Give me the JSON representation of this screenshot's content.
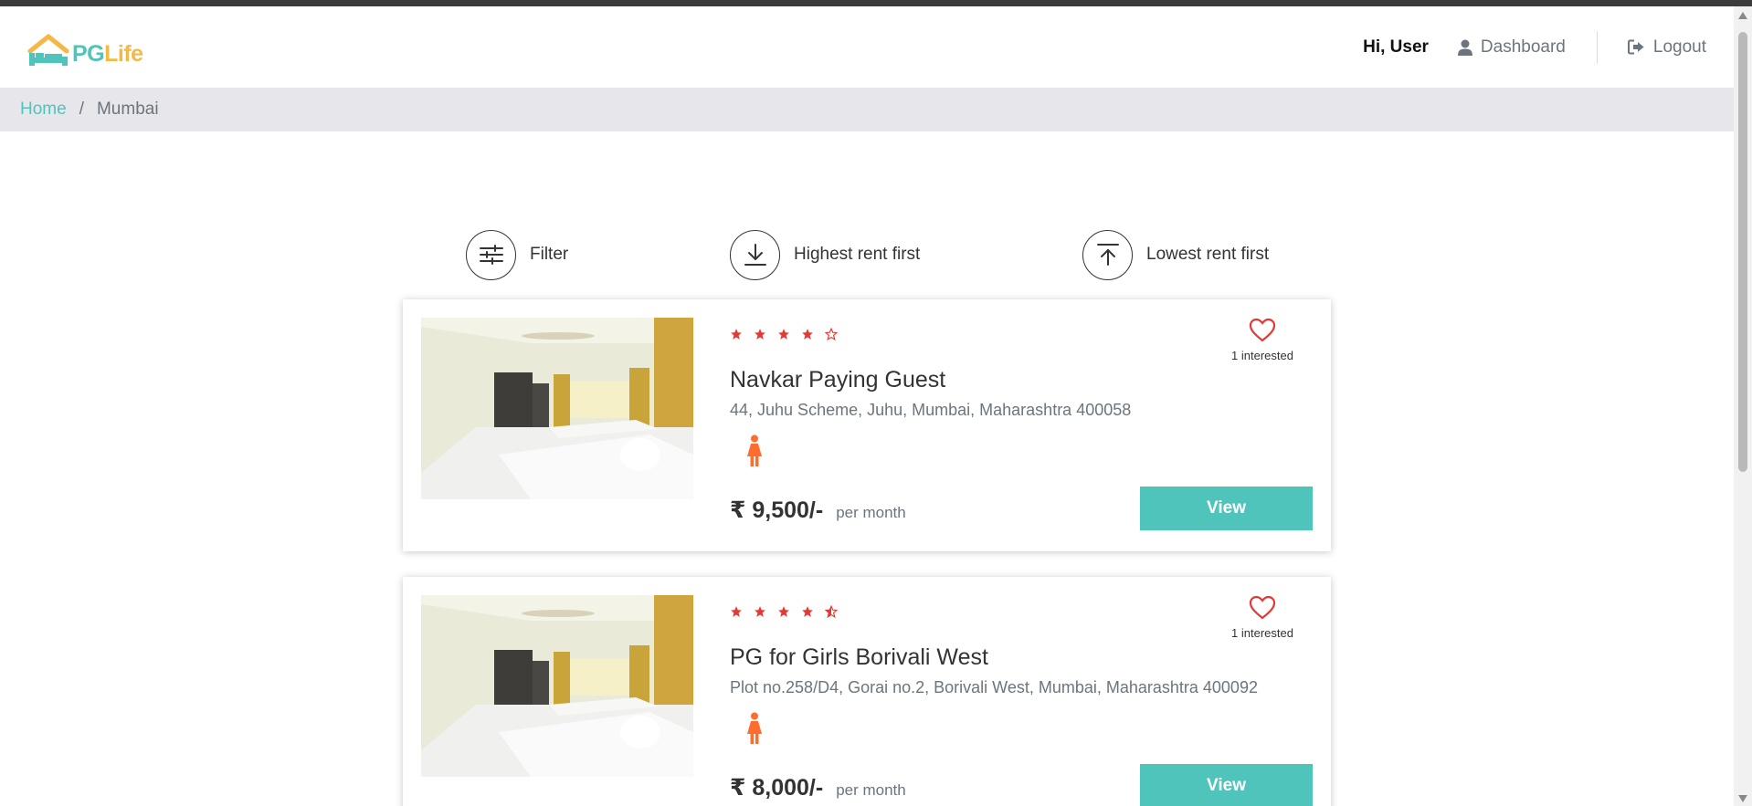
{
  "header": {
    "logo": {
      "pg": "PG",
      "life": "Life"
    },
    "greeting": "Hi, User",
    "dashboard_label": "Dashboard",
    "logout_label": "Logout"
  },
  "breadcrumb": {
    "home": "Home",
    "separator": "/",
    "current": "Mumbai"
  },
  "sort": {
    "filter_label": "Filter",
    "highest_label": "Highest rent first",
    "lowest_label": "Lowest rent first"
  },
  "listings": [
    {
      "name": "Navkar Paying Guest",
      "address": "44, Juhu Scheme, Juhu, Mumbai, Maharashtra 400058",
      "rating": 4,
      "stars": [
        "full",
        "full",
        "full",
        "full",
        "empty"
      ],
      "interested": "1 interested",
      "rent": "₹ 9,500/-",
      "per": "per month",
      "view_label": "View",
      "gender_icon": "female-icon"
    },
    {
      "name": "PG for Girls Borivali West",
      "address": "Plot no.258/D4, Gorai no.2, Borivali West, Mumbai, Maharashtra 400092",
      "rating": 4.5,
      "stars": [
        "full",
        "full",
        "full",
        "full",
        "half"
      ],
      "interested": "1 interested",
      "rent": "₹ 8,000/-",
      "per": "per month",
      "view_label": "View",
      "gender_icon": "female-icon"
    }
  ],
  "colors": {
    "accent": "#4fc4ba",
    "logo_yellow": "#f4b845",
    "star_red": "#e53935",
    "heart_red": "#e53935",
    "female_orange": "#ff6d2e",
    "breadcrumb_bg": "#e7e6ea"
  }
}
